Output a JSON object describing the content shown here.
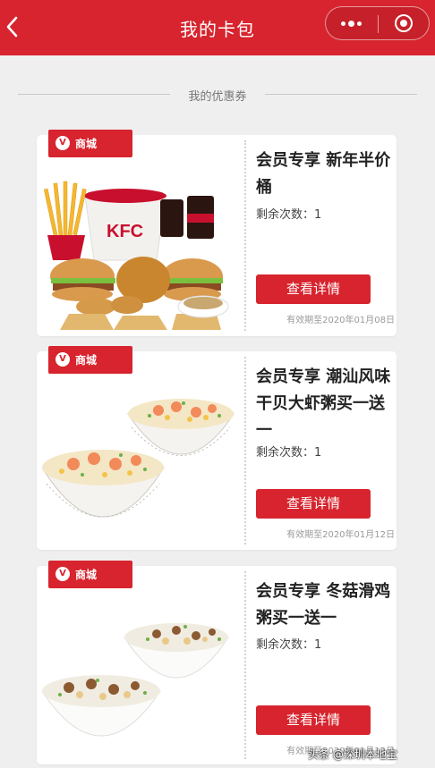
{
  "header": {
    "title": "我的卡包",
    "back_icon": "chevron-left-icon",
    "more_icon": "more-dots-icon",
    "close_icon": "target-close-icon"
  },
  "section": {
    "label": "我的优惠券"
  },
  "colors": {
    "accent": "#d7242e",
    "background": "#efefef"
  },
  "coupons": [
    {
      "tag": "商城",
      "tag_logo": "V",
      "title": "会员专享 新年半价桶",
      "remaining": "剩余次数：1",
      "button": "查看详情",
      "expiry": "有效期至2020年01月08日",
      "image": "kfc-family-bucket-meal"
    },
    {
      "tag": "商城",
      "tag_logo": "V",
      "title": "会员专享 潮汕风味干贝大虾粥买一送一",
      "remaining": "剩余次数：1",
      "button": "查看详情",
      "expiry": "有效期至2020年01月12日",
      "image": "shrimp-congee-two-bowls"
    },
    {
      "tag": "商城",
      "tag_logo": "V",
      "title": "会员专享 冬菇滑鸡粥买一送一",
      "remaining": "剩余次数：1",
      "button": "查看详情",
      "expiry": "有效期至2020年01月12日",
      "image": "mushroom-chicken-congee-two-bowls"
    }
  ],
  "watermark": "头条 @深圳本地宝"
}
